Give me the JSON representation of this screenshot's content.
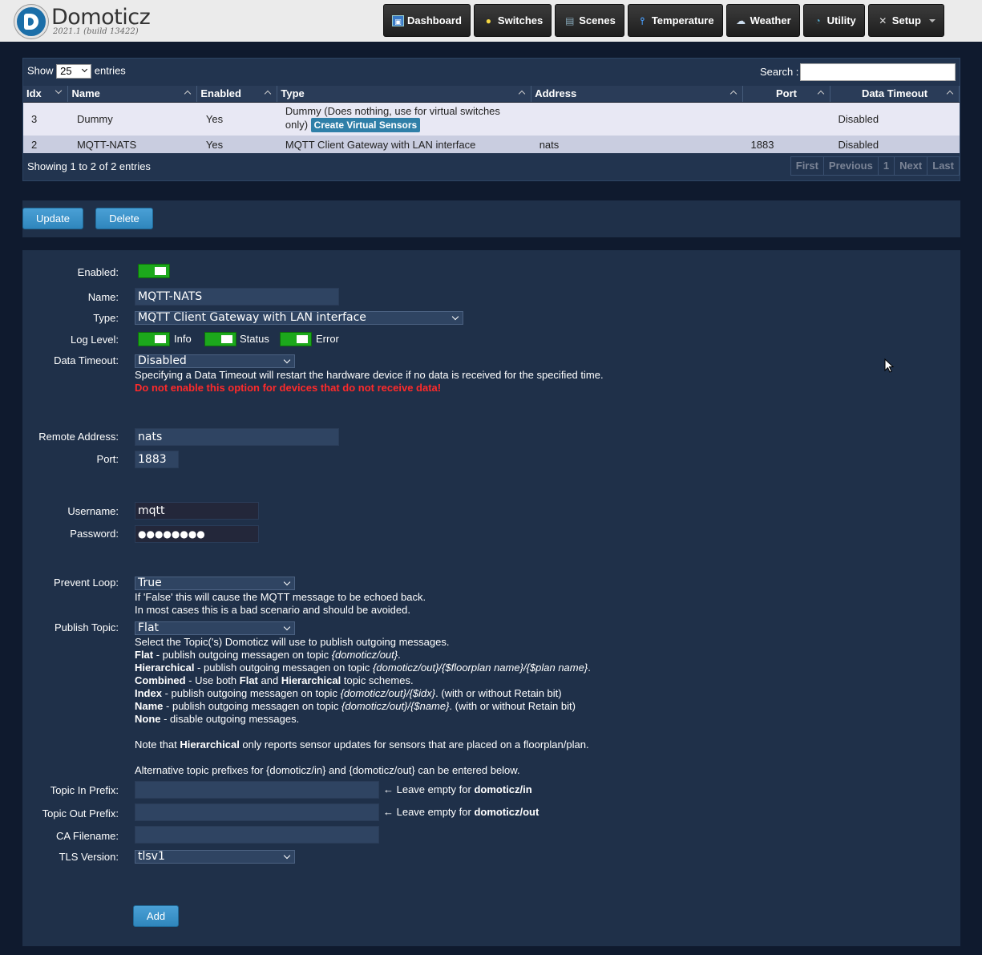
{
  "header": {
    "brand": "Domoticz",
    "build": "2021.1 (build 13422)",
    "nav": [
      {
        "label": "Dashboard",
        "icon": "dashboard-icon"
      },
      {
        "label": "Switches",
        "icon": "bulb-icon"
      },
      {
        "label": "Scenes",
        "icon": "clapper-icon"
      },
      {
        "label": "Temperature",
        "icon": "thermometer-icon"
      },
      {
        "label": "Weather",
        "icon": "weather-icon"
      },
      {
        "label": "Utility",
        "icon": "utility-icon"
      },
      {
        "label": "Setup",
        "icon": "tools-icon"
      }
    ]
  },
  "table": {
    "show_label": "Show",
    "entries_value": "25",
    "entries_label": "entries",
    "search_label": "Search :",
    "columns": [
      "Idx",
      "Name",
      "Enabled",
      "Type",
      "Address",
      "Port",
      "Data Timeout"
    ],
    "rows": [
      {
        "idx": "3",
        "name": "Dummy",
        "enabled": "Yes",
        "type": "Dummy (Does nothing, use for virtual switches only)",
        "type_button": "Create Virtual Sensors",
        "address": "",
        "port": "",
        "timeout": "Disabled"
      },
      {
        "idx": "2",
        "name": "MQTT-NATS",
        "enabled": "Yes",
        "type": "MQTT Client Gateway with LAN interface",
        "address": "nats",
        "port": "1883",
        "timeout": "Disabled"
      }
    ],
    "info": "Showing 1 to 2 of 2 entries",
    "pager": [
      "First",
      "Previous",
      "1",
      "Next",
      "Last"
    ]
  },
  "actions": {
    "update": "Update",
    "delete": "Delete"
  },
  "form": {
    "enabled_label": "Enabled:",
    "name_label": "Name:",
    "name_value": "MQTT-NATS",
    "type_label": "Type:",
    "type_value": "MQTT Client Gateway with LAN interface",
    "loglevel_label": "Log Level:",
    "log_info": "Info",
    "log_status": "Status",
    "log_error": "Error",
    "timeout_label": "Data Timeout:",
    "timeout_value": "Disabled",
    "timeout_help": "Specifying a Data Timeout will restart the hardware device if no data is received for the specified time.",
    "timeout_warning": "Do not enable this option for devices that do not receive data!",
    "address_label": "Remote Address:",
    "address_value": "nats",
    "port_label": "Port:",
    "port_value": "1883",
    "username_label": "Username:",
    "username_value": "mqtt",
    "password_label": "Password:",
    "password_value": "●●●●●●●●",
    "loop_label": "Prevent Loop:",
    "loop_value": "True",
    "loop_help1": "If 'False' this will cause the MQTT message to be echoed back.",
    "loop_help2": "In most cases this is a bad scenario and should be avoided.",
    "publish_label": "Publish Topic:",
    "publish_value": "Flat",
    "publish_help": "Select the Topic('s) Domoticz will use to publish outgoing messages.",
    "flat_b": "Flat",
    "flat_t": " - publish outgoing messagen on topic ",
    "flat_i": "{domoticz/out}",
    "hier_b": "Hierarchical",
    "hier_t": " - publish outgoing messagen on topic ",
    "hier_i": "{domoticz/out}/{$floorplan name}/{$plan name}",
    "comb_b": "Combined",
    "comb_t1": " - Use both ",
    "comb_b2": "Flat",
    "comb_t2": " and ",
    "comb_b3": "Hierarchical",
    "comb_t3": " topic schemes.",
    "index_b": "Index",
    "index_t": " - publish outgoing messagen on topic ",
    "index_i": "{domoticz/out}/{$idx}",
    "index_t2": ". (with or without Retain bit)",
    "nm_b": "Name",
    "nm_t": " - publish outgoing messagen on topic ",
    "nm_i": "{domoticz/out}/{$name}",
    "nm_t2": ". (with or without Retain bit)",
    "none_b": "None",
    "none_t": " - disable outgoing messages.",
    "note_t1": "Note that ",
    "note_b": "Hierarchical",
    "note_t2": " only reports sensor updates for sensors that are placed on a floorplan/plan.",
    "alt_help": "Alternative topic prefixes for {domoticz/in} and {domoticz/out} can be entered below.",
    "topic_in_label": "Topic In Prefix:",
    "topic_in_hint": "← Leave empty for ",
    "topic_in_hint_b": "domoticz/in",
    "topic_out_label": "Topic Out Prefix:",
    "topic_out_hint": "← Leave empty for ",
    "topic_out_hint_b": "domoticz/out",
    "ca_label": "CA Filename:",
    "tls_label": "TLS Version:",
    "tls_value": "tlsv1",
    "add": "Add"
  }
}
